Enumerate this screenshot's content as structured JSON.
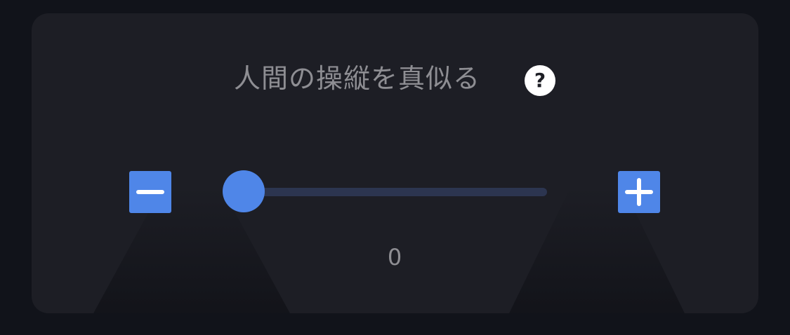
{
  "panel": {
    "title": "人間の操縦を真似る",
    "help_icon": "question-mark-icon",
    "help_glyph": "?"
  },
  "slider": {
    "value": "0",
    "level_fraction": 0,
    "minus_icon": "minus-icon",
    "plus_icon": "plus-icon"
  },
  "colors": {
    "accent": "#4f86e8",
    "track": "#2c3550",
    "panel_bg": "#1d1e25",
    "page_bg": "#11131a",
    "text_muted": "#8e8e93"
  }
}
